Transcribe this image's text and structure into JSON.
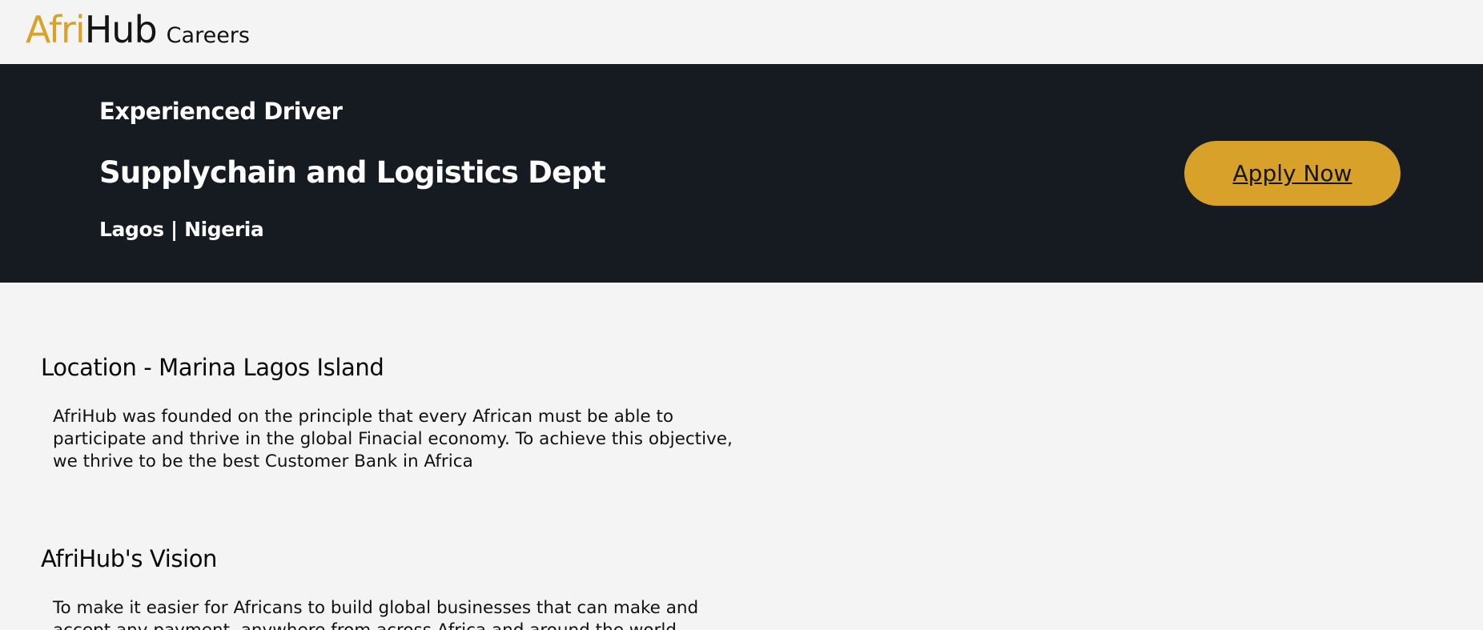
{
  "header": {
    "logo_part1": "Afri",
    "logo_part2": "Hub",
    "section_title": "Careers"
  },
  "job": {
    "title": "Experienced Driver",
    "department": "Supplychain and Logistics Dept",
    "location": "Lagos | Nigeria",
    "apply_label": "Apply Now"
  },
  "sections": [
    {
      "heading": "Location - Marina Lagos Island",
      "body": "AfriHub was founded on the principle that every African must be able to participate and thrive in the global Finacial economy. To achieve this objective, we thrive to be the best Customer Bank in Africa"
    },
    {
      "heading": "AfriHub's Vision",
      "body": "To make it easier for Africans to build global businesses that can make and accept any payment, anywhere from across Africa and around the world"
    }
  ],
  "colors": {
    "brand_gold": "#d8a22a",
    "hero_background": "#161b22",
    "page_background": "#f4f4f4"
  }
}
